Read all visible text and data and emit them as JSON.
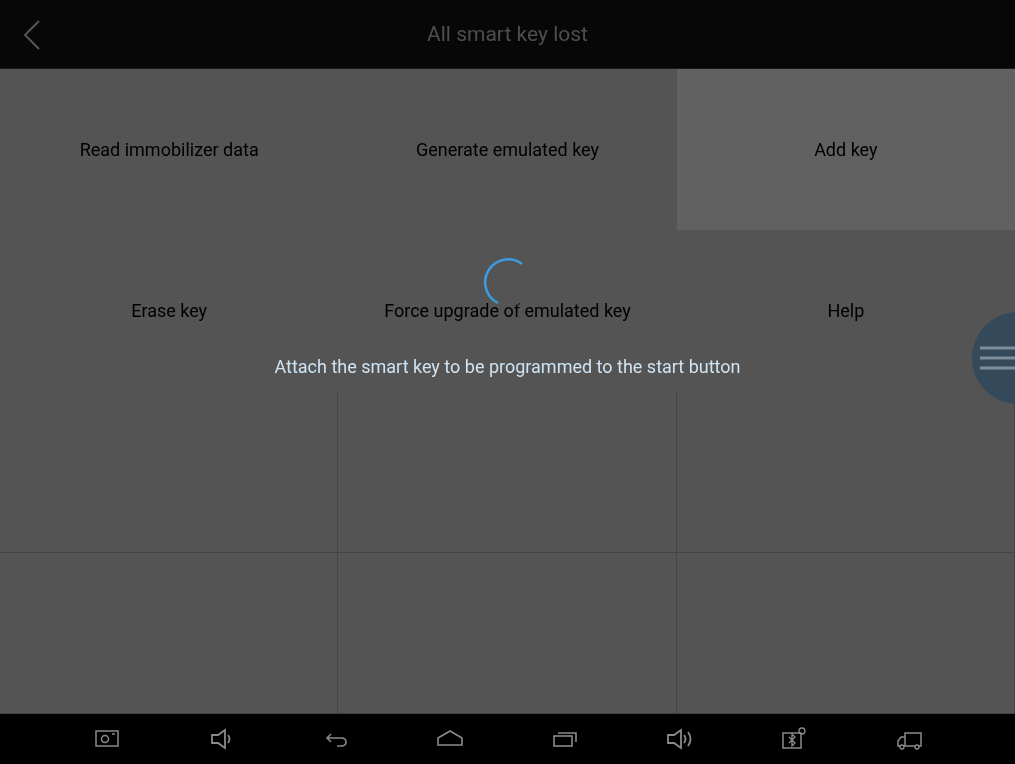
{
  "header": {
    "title": "All smart key lost"
  },
  "functions": [
    {
      "label": "Read immobilizer data",
      "selected": false
    },
    {
      "label": "Generate emulated key",
      "selected": false
    },
    {
      "label": "Add key",
      "selected": true
    },
    {
      "label": "Erase key",
      "selected": false
    },
    {
      "label": "Force upgrade of emulated key",
      "selected": false
    },
    {
      "label": "Help",
      "selected": false
    }
  ],
  "progress_dialog": {
    "message": "Attach the smart key to be programmed to the start button"
  }
}
